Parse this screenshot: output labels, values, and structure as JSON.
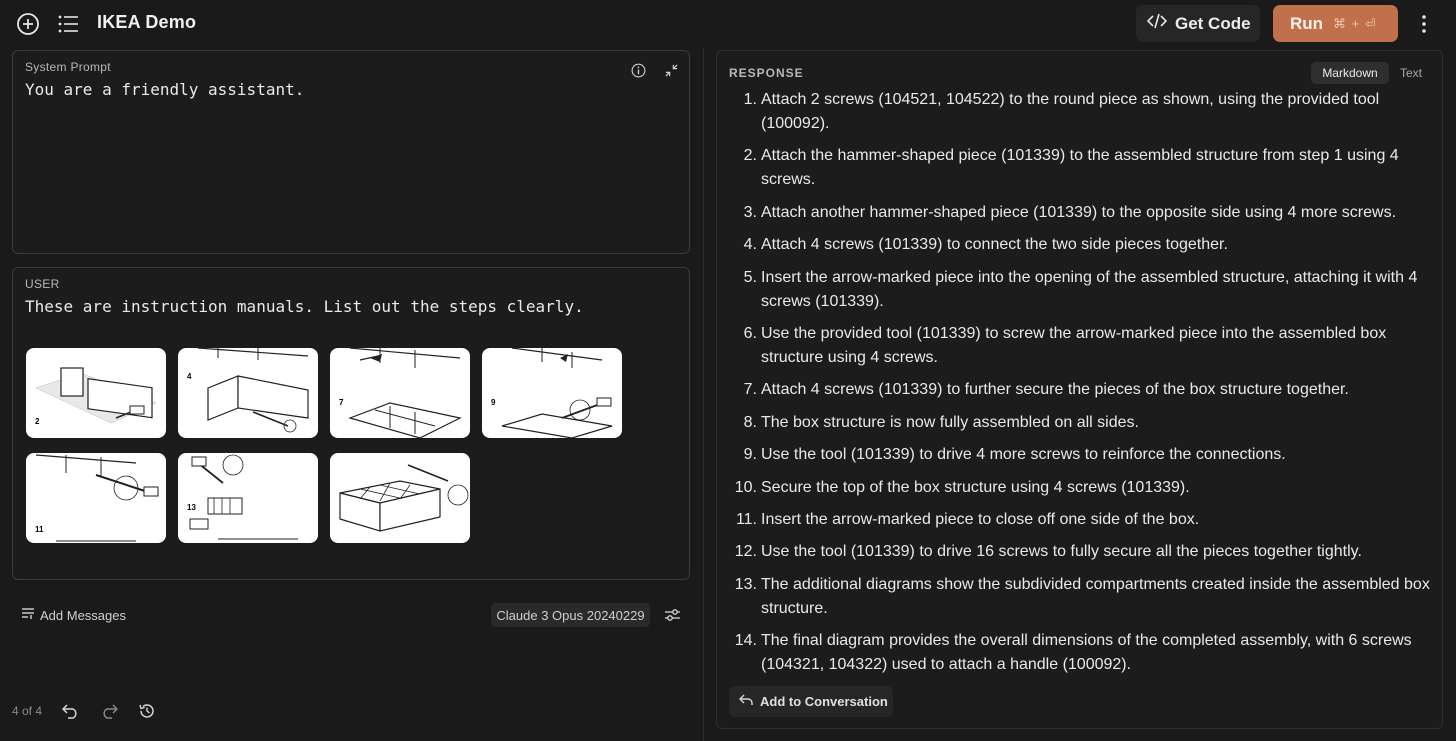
{
  "app": {
    "title": "IKEA Demo"
  },
  "toolbar": {
    "get_code_label": "Get Code",
    "run_label": "Run",
    "run_shortcut": "⌘ + ⏎"
  },
  "system_prompt": {
    "label": "System Prompt",
    "value": "You are a friendly assistant."
  },
  "user": {
    "label": "USER",
    "message": "These are instruction manuals. List out the steps clearly.",
    "attachments": [
      {
        "step_number": "2"
      },
      {
        "step_number": "4"
      },
      {
        "step_number": "7"
      },
      {
        "step_number": "9"
      },
      {
        "step_number": "11"
      },
      {
        "step_number": "13"
      },
      {
        "step_number": ""
      }
    ]
  },
  "footer": {
    "add_messages_label": "Add Messages",
    "model_name": "Claude 3 Opus 20240229",
    "page_indicator": "4 of 4"
  },
  "response": {
    "label": "RESPONSE",
    "format_options": [
      "Markdown",
      "Text"
    ],
    "selected_format": "Markdown",
    "steps": [
      {
        "num": "1.",
        "text": "Attach 2 screws (104521, 104522) to the round piece as shown, using the provided tool (100092)."
      },
      {
        "num": "2.",
        "text": "Attach the hammer-shaped piece (101339) to the assembled structure from step 1 using 4 screws."
      },
      {
        "num": "3.",
        "text": "Attach another hammer-shaped piece (101339) to the opposite side using 4 more screws."
      },
      {
        "num": "4.",
        "text": "Attach 4 screws (101339) to connect the two side pieces together."
      },
      {
        "num": "5.",
        "text": "Insert the arrow-marked piece into the opening of the assembled structure, attaching it with 4 screws (101339)."
      },
      {
        "num": "6.",
        "text": "Use the provided tool (101339) to screw the arrow-marked piece into the assembled box structure using 4 screws."
      },
      {
        "num": "7.",
        "text": "Attach 4 screws (101339) to further secure the pieces of the box structure together."
      },
      {
        "num": "8.",
        "text": "The box structure is now fully assembled on all sides."
      },
      {
        "num": "9.",
        "text": "Use the tool (101339) to drive 4 more screws to reinforce the connections."
      },
      {
        "num": "10.",
        "text": "Secure the top of the box structure using 4 screws (101339)."
      },
      {
        "num": "11.",
        "text": "Insert the arrow-marked piece to close off one side of the box."
      },
      {
        "num": "12.",
        "text": "Use the tool (101339) to drive 16 screws to fully secure all the pieces together tightly."
      },
      {
        "num": "13.",
        "text": "The additional diagrams show the subdivided compartments created inside the assembled box structure."
      },
      {
        "num": "14.",
        "text": "The final diagram provides the overall dimensions of the completed assembly, with 6 screws (104321, 104322) used to attach a handle (100092)."
      }
    ],
    "add_to_conversation_label": "Add to Conversation"
  },
  "colors": {
    "background": "#1a1a1a",
    "run_button": "#c0704a",
    "panel_border": "#3a3a3a"
  },
  "icons": [
    "plus-circle-icon",
    "list-menu-icon",
    "code-icon",
    "more-vertical-icon",
    "info-icon",
    "collapse-icon",
    "add-messages-icon",
    "settings-sliders-icon",
    "undo-icon",
    "redo-icon",
    "history-icon",
    "reply-icon"
  ]
}
